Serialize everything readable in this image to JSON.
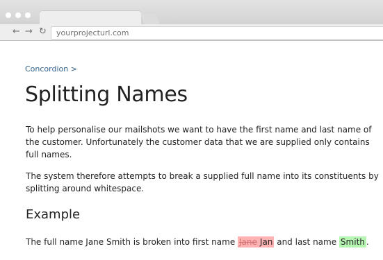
{
  "browser": {
    "url": "yourprojecturl.com",
    "back_glyph": "←",
    "forward_glyph": "→",
    "reload_glyph": "↻"
  },
  "page": {
    "breadcrumb": "Concordion >",
    "title": "Splitting Names",
    "paragraph1": "To help personalise our mailshots we want to have the first name and last name of the customer. Unfortunately the customer data that we are supplied only contains full names.",
    "paragraph2": "The system therefore attempts to break a supplied full name into its constituents by splitting around whitespace.",
    "subheading": "Example",
    "example": {
      "prefix": "The full name Jane Smith is broken into first name ",
      "expected_first": "Jane",
      "actual_first": "Jan",
      "middle": " and last name ",
      "last": "Smith",
      "suffix": "."
    }
  },
  "colors": {
    "failure_highlight": "#ffb3b3",
    "success_highlight": "#b6f5b2",
    "breadcrumb_link": "#2f5f87"
  }
}
